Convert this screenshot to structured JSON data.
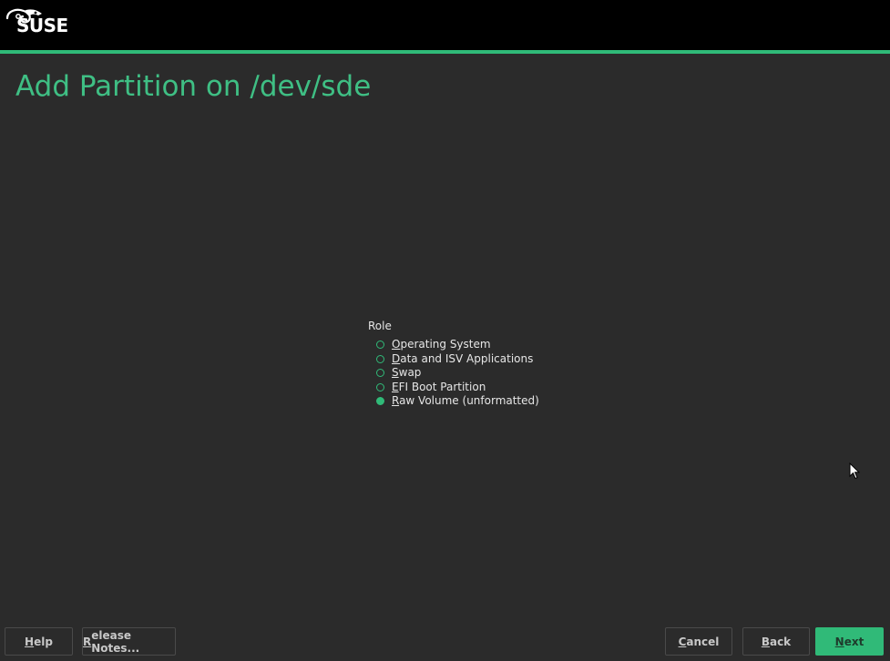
{
  "brand": {
    "name": "SUSE",
    "accent_color": "#30ba78",
    "title_color": "#3fbf84"
  },
  "page": {
    "title": "Add Partition on /dev/sde"
  },
  "role": {
    "label": "Role",
    "selected": "Raw Volume (unformatted)",
    "options": [
      {
        "mnemonic": "O",
        "rest": "perating System",
        "checked": false
      },
      {
        "mnemonic": "D",
        "rest": "ata and ISV Applications",
        "checked": false
      },
      {
        "mnemonic": "S",
        "rest": "wap",
        "checked": false
      },
      {
        "mnemonic": "E",
        "rest": "FI Boot Partition",
        "checked": false
      },
      {
        "mnemonic": "R",
        "rest": "aw Volume (unformatted)",
        "checked": true
      }
    ]
  },
  "footer": {
    "help": {
      "mnemonic": "H",
      "rest": "elp"
    },
    "release_notes": {
      "mnemonic": "R",
      "rest": "elease Notes..."
    },
    "cancel": {
      "mnemonic": "C",
      "rest": "ancel"
    },
    "back": {
      "mnemonic": "B",
      "rest": "ack"
    },
    "next": {
      "mnemonic": "N",
      "rest": "ext"
    }
  }
}
